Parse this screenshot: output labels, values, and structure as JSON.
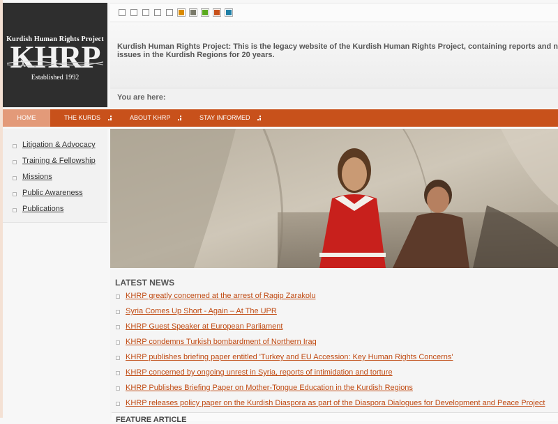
{
  "logo": {
    "line1": "Kurdish Human Rights Project",
    "acronym": "KHRP",
    "established": "Established 1992"
  },
  "toolbar": {
    "tools": [
      {
        "name": "two-column-layout-icon",
        "type": "mono"
      },
      {
        "name": "fluid-width-icon",
        "type": "mono"
      },
      {
        "name": "increase-font-icon",
        "type": "mono"
      },
      {
        "name": "decrease-font-icon",
        "type": "mono"
      },
      {
        "name": "reset-font-icon",
        "type": "mono"
      },
      {
        "name": "color-theme-orange",
        "type": "color",
        "color": "#d98a00"
      },
      {
        "name": "color-theme-olive",
        "type": "color",
        "color": "#7a7a6a"
      },
      {
        "name": "color-theme-green",
        "type": "color",
        "color": "#5aaa1e"
      },
      {
        "name": "color-theme-rust",
        "type": "color",
        "color": "#c8511b"
      },
      {
        "name": "color-theme-blue",
        "type": "color",
        "color": "#1e7fa6"
      }
    ]
  },
  "header": {
    "description": "Kurdish Human Rights Project: This is the legacy website of the Kurdish Human Rights Project, containing reports and n issues in the Kurdish Regions for 20 years.",
    "breadcrumb_label": "You are here:"
  },
  "nav": {
    "items": [
      {
        "label": "HOME",
        "active": true
      },
      {
        "label": "THE KURDS",
        "active": false
      },
      {
        "label": "ABOUT KHRP",
        "active": false
      },
      {
        "label": "STAY INFORMED",
        "active": false
      }
    ]
  },
  "sidebar": {
    "items": [
      "Litigation & Advocacy",
      "Training & Fellowship",
      "Missions",
      "Public Awareness",
      "Publications"
    ]
  },
  "news": {
    "heading": "LATEST NEWS",
    "items": [
      "KHRP greatly concerned at the arrest of Ragip Zarakolu",
      "Syria Comes Up Short - Again – At The UPR",
      "KHRP Guest Speaker at European Parliament",
      "KHRP condemns Turkish bombardment of Northern Iraq",
      "KHRP publishes briefing paper entitled 'Turkey and EU Accession: Key Human Rights Concerns'",
      "KHRP concerned by ongoing unrest in Syria, reports of intimidation and torture",
      "KHRP Publishes Briefing Paper on Mother-Tongue Education in the Kurdish Regions",
      "KHRP releases policy paper on the Kurdish Diaspora as part of the Diaspora Dialogues for Development and Peace Project"
    ],
    "feature_heading": "FEATURE ARTICLE"
  },
  "colors": {
    "accent": "#c8511b",
    "link": "#c04a12",
    "logo_bg": "#2e2e2e"
  }
}
